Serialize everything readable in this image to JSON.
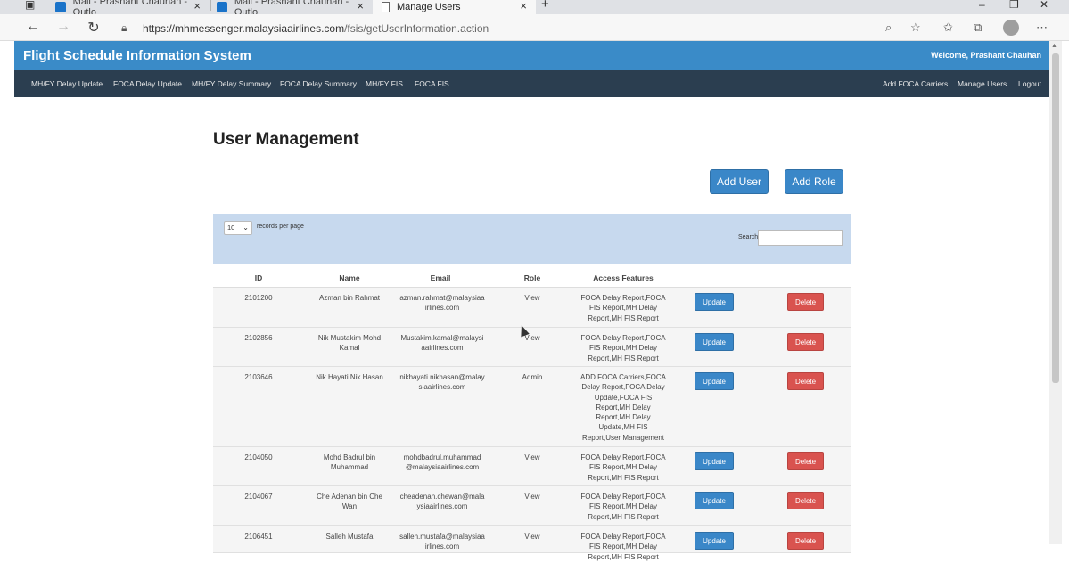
{
  "browser": {
    "tabs": [
      {
        "title": "Mail - Prashant Chauhan - Outlo",
        "active": false
      },
      {
        "title": "Mail - Prashant Chauhan - Outlo",
        "active": false
      },
      {
        "title": "Manage Users",
        "active": true
      }
    ],
    "new_tab": "+",
    "url_host": "https://mhmessenger.malaysiaairlines.com",
    "url_path": "/fsis/getUserInformation.action"
  },
  "header": {
    "title": "Flight Schedule Information System",
    "welcome": "Welcome, Prashant Chauhan"
  },
  "nav": {
    "left": [
      "MH/FY Delay Update",
      "FOCA Delay Update",
      "MH/FY Delay Summary",
      "FOCA Delay Summary",
      "MH/FY FIS",
      "FOCA FIS"
    ],
    "right": [
      "Add FOCA Carriers",
      "Manage Users",
      "Logout"
    ]
  },
  "page": {
    "title": "User Management",
    "add_user": "Add User",
    "add_role": "Add Role"
  },
  "table_controls": {
    "page_size": "10",
    "records_per_page": "records per page",
    "search_label": "Search:",
    "search_value": ""
  },
  "table": {
    "columns": [
      "ID",
      "Name",
      "Email",
      "Role",
      "Access Features"
    ],
    "update_label": "Update",
    "delete_label": "Delete",
    "rows": [
      {
        "id": "2101200",
        "name": [
          "Azman bin Rahmat"
        ],
        "email": [
          "azman.rahmat@malaysiaa",
          "irlines.com"
        ],
        "role": "View",
        "features": [
          "FOCA Delay Report,FOCA",
          "FIS Report,MH Delay",
          "Report,MH FIS Report"
        ]
      },
      {
        "id": "2102856",
        "name": [
          "Nik Mustakim Mohd",
          "Kamal"
        ],
        "email": [
          "Mustakim.kamal@malaysi",
          "aairlines.com"
        ],
        "role": "View",
        "features": [
          "FOCA Delay Report,FOCA",
          "FIS Report,MH Delay",
          "Report,MH FIS Report"
        ]
      },
      {
        "id": "2103646",
        "name": [
          "Nik Hayati Nik Hasan"
        ],
        "email": [
          "nikhayati.nikhasan@malay",
          "siaairlines.com"
        ],
        "role": "Admin",
        "features": [
          "ADD FOCA Carriers,FOCA",
          "Delay Report,FOCA Delay",
          "Update,FOCA FIS",
          "Report,MH Delay",
          "Report,MH Delay",
          "Update,MH FIS",
          "Report,User Management"
        ]
      },
      {
        "id": "2104050",
        "name": [
          "Mohd Badrul bin",
          "Muhammad"
        ],
        "email": [
          "mohdbadrul.muhammad",
          "@malaysiaairlines.com"
        ],
        "role": "View",
        "features": [
          "FOCA Delay Report,FOCA",
          "FIS Report,MH Delay",
          "Report,MH FIS Report"
        ]
      },
      {
        "id": "2104067",
        "name": [
          "Che Adenan bin Che Wan"
        ],
        "email": [
          "cheadenan.chewan@mala",
          "ysiaairlines.com"
        ],
        "role": "View",
        "features": [
          "FOCA Delay Report,FOCA",
          "FIS Report,MH Delay",
          "Report,MH FIS Report"
        ]
      },
      {
        "id": "2106451",
        "name": [
          "Salleh Mustafa"
        ],
        "email": [
          "salleh.mustafa@malaysiaa",
          "irlines.com"
        ],
        "role": "View",
        "features": [
          "FOCA Delay Report,FOCA",
          "FIS Report,MH Delay",
          "Report,MH FIS Report"
        ]
      }
    ]
  }
}
